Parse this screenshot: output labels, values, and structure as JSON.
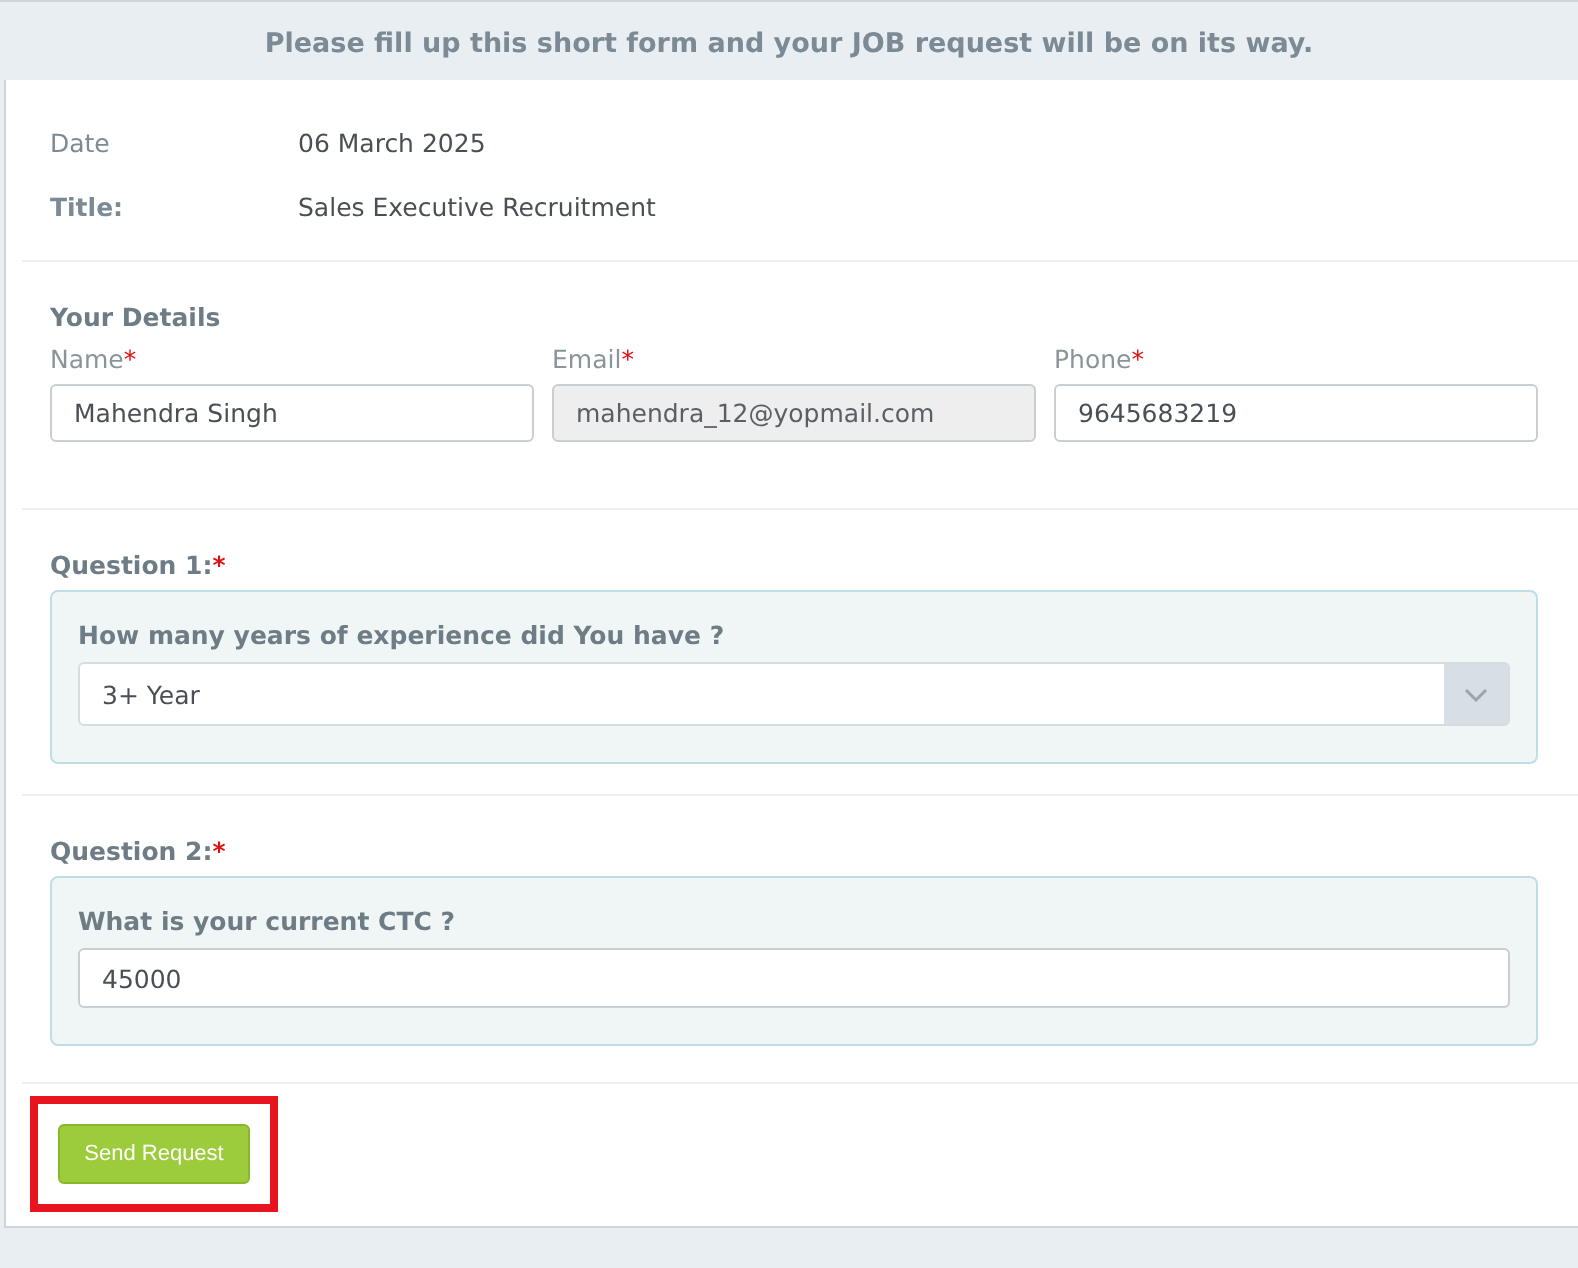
{
  "banner": {
    "text": "Please fill up this short form and your JOB request will be on its way."
  },
  "info": [
    {
      "label": "Date",
      "bold": false,
      "value": "06 March 2025"
    },
    {
      "label": "Title:",
      "bold": true,
      "value": "Sales Executive Recruitment"
    }
  ],
  "details": {
    "heading": "Your Details",
    "fields": [
      {
        "label": "Name",
        "required_mark": "*",
        "value": "Mahendra Singh",
        "disabled": false
      },
      {
        "label": "Email",
        "required_mark": "*",
        "value": "mahendra_12@yopmail.com",
        "disabled": true
      },
      {
        "label": "Phone",
        "required_mark": "*",
        "value": "9645683219",
        "disabled": false
      }
    ]
  },
  "questions": [
    {
      "label": "Question 1:",
      "required_mark": "*",
      "prompt": "How many years of experience did You have ?",
      "kind": "select",
      "value": "3+ Year"
    },
    {
      "label": "Question 2:",
      "required_mark": "*",
      "prompt": "What is your current CTC ?",
      "kind": "text",
      "value": "45000"
    }
  ],
  "submit": {
    "label": "Send Request",
    "highlighted": true
  }
}
